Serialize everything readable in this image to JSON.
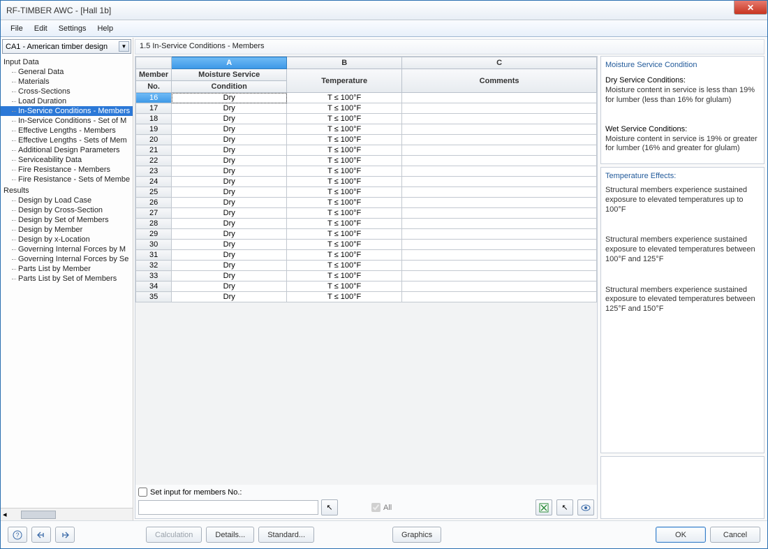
{
  "window": {
    "title": "RF-TIMBER AWC - [Hall 1b]"
  },
  "menu": [
    "File",
    "Edit",
    "Settings",
    "Help"
  ],
  "combo": {
    "value": "CA1 - American timber design"
  },
  "tree": {
    "groups": [
      {
        "label": "Input Data",
        "items": [
          "General Data",
          "Materials",
          "Cross-Sections",
          "Load Duration",
          "In-Service Conditions - Members",
          "In-Service Conditions - Set of M",
          "Effective Lengths - Members",
          "Effective Lengths - Sets of Mem",
          "Additional Design Parameters",
          "Serviceability Data",
          "Fire Resistance - Members",
          "Fire Resistance - Sets of Membe"
        ],
        "selected": 4
      },
      {
        "label": "Results",
        "items": [
          "Design by Load Case",
          "Design by Cross-Section",
          "Design by Set of Members",
          "Design by Member",
          "Design by x-Location",
          "Governing Internal Forces by M",
          "Governing Internal Forces by Se",
          "Parts List by Member",
          "Parts List by Set of Members"
        ],
        "selected": -1
      }
    ]
  },
  "content_title": "1.5 In-Service Conditions - Members",
  "grid": {
    "colLetters": [
      "A",
      "B",
      "C"
    ],
    "header1_member": "Member",
    "header2_member": "No.",
    "header1_A": "Moisture Service",
    "header2_A": "Condition",
    "header_B": "Temperature",
    "header_C": "Comments",
    "selected_row": 16,
    "rows": [
      {
        "no": "16",
        "a": "Dry",
        "b": "T ≤ 100°F",
        "c": ""
      },
      {
        "no": "17",
        "a": "Dry",
        "b": "T ≤ 100°F",
        "c": ""
      },
      {
        "no": "18",
        "a": "Dry",
        "b": "T ≤ 100°F",
        "c": ""
      },
      {
        "no": "19",
        "a": "Dry",
        "b": "T ≤ 100°F",
        "c": ""
      },
      {
        "no": "20",
        "a": "Dry",
        "b": "T ≤ 100°F",
        "c": ""
      },
      {
        "no": "21",
        "a": "Dry",
        "b": "T ≤ 100°F",
        "c": ""
      },
      {
        "no": "22",
        "a": "Dry",
        "b": "T ≤ 100°F",
        "c": ""
      },
      {
        "no": "23",
        "a": "Dry",
        "b": "T ≤ 100°F",
        "c": ""
      },
      {
        "no": "24",
        "a": "Dry",
        "b": "T ≤ 100°F",
        "c": ""
      },
      {
        "no": "25",
        "a": "Dry",
        "b": "T ≤ 100°F",
        "c": ""
      },
      {
        "no": "26",
        "a": "Dry",
        "b": "T ≤ 100°F",
        "c": ""
      },
      {
        "no": "27",
        "a": "Dry",
        "b": "T ≤ 100°F",
        "c": ""
      },
      {
        "no": "28",
        "a": "Dry",
        "b": "T ≤ 100°F",
        "c": ""
      },
      {
        "no": "29",
        "a": "Dry",
        "b": "T ≤ 100°F",
        "c": ""
      },
      {
        "no": "30",
        "a": "Dry",
        "b": "T ≤ 100°F",
        "c": ""
      },
      {
        "no": "31",
        "a": "Dry",
        "b": "T ≤ 100°F",
        "c": ""
      },
      {
        "no": "32",
        "a": "Dry",
        "b": "T ≤ 100°F",
        "c": ""
      },
      {
        "no": "33",
        "a": "Dry",
        "b": "T ≤ 100°F",
        "c": ""
      },
      {
        "no": "34",
        "a": "Dry",
        "b": "T ≤ 100°F",
        "c": ""
      },
      {
        "no": "35",
        "a": "Dry",
        "b": "T ≤ 100°F",
        "c": ""
      }
    ]
  },
  "below": {
    "checkbox_label": "Set input for members No.:",
    "all_label": "All"
  },
  "info1": {
    "title": "Moisture Service Condition",
    "sub1": "Dry Service Conditions:",
    "text1": "Moisture content in service is less than 19% for lumber (less than 16% for glulam)",
    "sub2": "Wet Service Conditions:",
    "text2": "Moisture content in service is 19% or greater for lumber (16% and greater for glulam)"
  },
  "info2": {
    "title": "Temperature Effects:",
    "t1": "Structural members experience sustained exposure to elevated temperatures up to 100°F",
    "t2": "Structural members experience sustained exposure to elevated temperatures between 100°F and 125°F",
    "t3": "Structural members experience sustained exposure to elevated temperatures between 125°F and 150°F"
  },
  "footer": {
    "calculation": "Calculation",
    "details": "Details...",
    "standard": "Standard...",
    "graphics": "Graphics",
    "ok": "OK",
    "cancel": "Cancel"
  }
}
